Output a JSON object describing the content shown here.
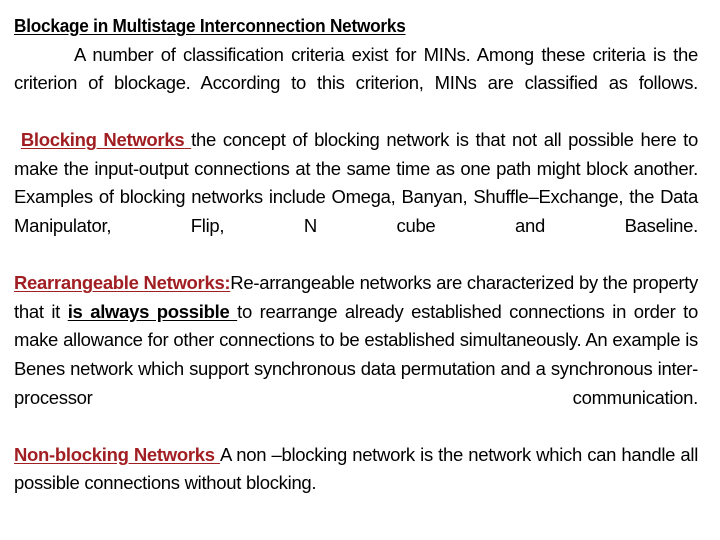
{
  "document": {
    "title": "Blockage in Multistage Interconnection Networks",
    "background_color": "#FFFFFF",
    "heading_color": "#A11E22",
    "body_color": "#000000",
    "paragraphs": {
      "intro": {
        "text": "A number of classification criteria exist for MINs. Among these criteria is the criterion of blockage. According to this criterion, MINs are classified as follows."
      },
      "blocking": {
        "heading": "Blocking Networks",
        "heading_trailing": "  ",
        "text": "the concept of blocking network is that not all possible here to make the input-output connections at the same time as one path might block another. Examples of blocking networks include Omega, Banyan, Shuffle–Exchange, the Data Manipulator, Flip, N cube and Baseline."
      },
      "rearrangeable": {
        "heading": "Rearrangeable Networks:",
        "text_before_emph": "Re-arrangeable networks are characterized by the property that it ",
        "emphasis": "is always possible ",
        "text_after_emph": "to rearrange already established connections in order to make allowance for other connections to be established simultaneously. An example is Benes network which support synchronous data permutation and a synchronous inter-processor communication."
      },
      "nonblocking": {
        "heading": "Non-blocking Networks ",
        "text": "A non –blocking network is the network which can handle all possible connections without blocking."
      }
    }
  }
}
